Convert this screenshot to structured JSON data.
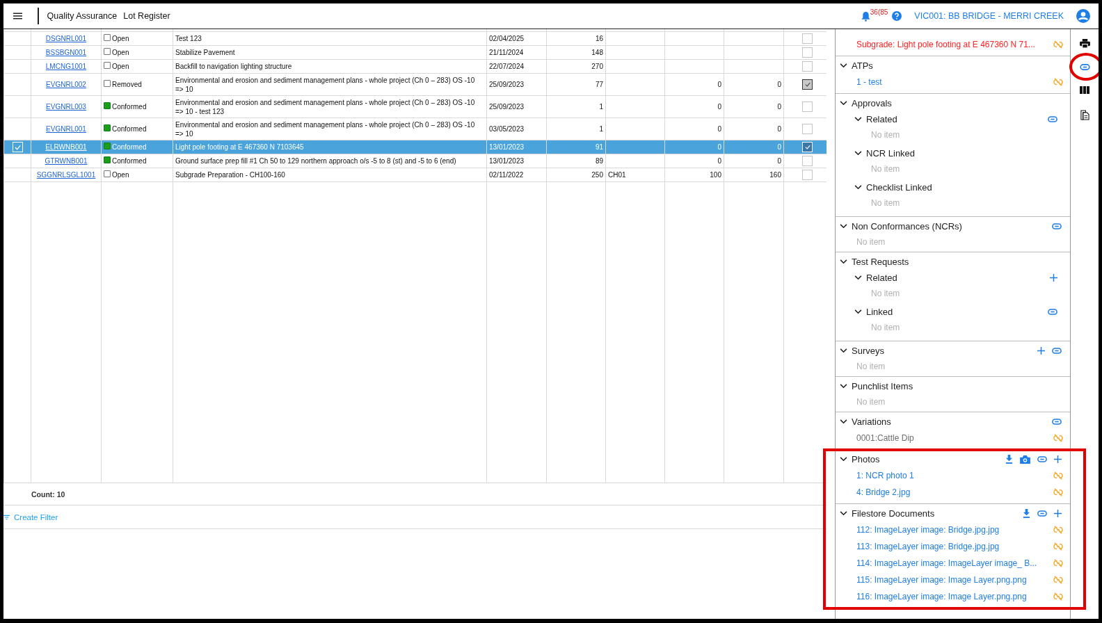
{
  "top_bar": {
    "module": "Quality Assurance",
    "page": "Lot Register",
    "notifications": "36(85",
    "project": "VIC001: BB BRIDGE - MERRI CREEK"
  },
  "table": {
    "rows": [
      {
        "selected": false,
        "lot": "DSGNRL001",
        "status_done": false,
        "status": "Open",
        "description": "Test 123",
        "date": "02/04/2025",
        "column_5": "16",
        "column_6": "",
        "column_7": "",
        "column_8": "",
        "checked": false
      },
      {
        "selected": false,
        "lot": "BSSBGN001",
        "status_done": false,
        "status": "Open",
        "description": "Stabilize Pavement",
        "date": "21/11/2024",
        "column_5": "148",
        "column_6": "",
        "column_7": "",
        "column_8": "",
        "checked": false
      },
      {
        "selected": false,
        "lot": "LMCNG1001",
        "status_done": false,
        "status": "Open",
        "description": "Backfill to navigation lighting structure",
        "date": "22/07/2024",
        "column_5": "270",
        "column_6": "",
        "column_7": "",
        "column_8": "",
        "checked": false
      },
      {
        "selected": false,
        "lot": "EVGNRL002",
        "status_done": false,
        "status": "Removed",
        "description": "Environmental and erosion and sediment management plans - whole project (Ch 0 – 283) OS -10 => 10",
        "date": "25/09/2023",
        "column_5": "77",
        "column_6": "",
        "column_7": "0",
        "column_8": "0",
        "checked": true
      },
      {
        "selected": false,
        "lot": "EVGNRL003",
        "status_done": true,
        "status": "Conformed",
        "description": "Environmental and erosion and sediment management plans - whole project (Ch 0 – 283) OS -10 => 10 - test 123",
        "date": "25/09/2023",
        "column_5": "1",
        "column_6": "",
        "column_7": "0",
        "column_8": "0",
        "checked": false
      },
      {
        "selected": false,
        "lot": "EVGNRL001",
        "status_done": true,
        "status": "Conformed",
        "description": "Environmental and erosion and sediment management plans - whole project (Ch 0 – 283) OS -10 => 10",
        "date": "03/05/2023",
        "column_5": "1",
        "column_6": "",
        "column_7": "0",
        "column_8": "0",
        "checked": false
      },
      {
        "selected": true,
        "lot": "ELRWNB001",
        "status_done": true,
        "status": "Conformed",
        "description": "Light pole footing at E 467360 N 7103645",
        "date": "13/01/2023",
        "column_5": "91",
        "column_6": "",
        "column_7": "0",
        "column_8": "0",
        "checked": true
      },
      {
        "selected": false,
        "lot": "GTRWNB001",
        "status_done": true,
        "status": "Conformed",
        "description": "Ground surface prep fill #1 Ch 50 to 129 northern approach o/s -5 to 8 (st) and -5 to 6 (end)",
        "date": "13/01/2023",
        "column_5": "89",
        "column_6": "",
        "column_7": "0",
        "column_8": "0",
        "checked": false
      },
      {
        "selected": false,
        "lot": "SGGNRLSGL1001",
        "status_done": false,
        "status": "Open",
        "description": "Subgrade Preparation - CH100-160",
        "date": "02/11/2022",
        "column_5": "250",
        "column_6": "CH01",
        "column_7": "100",
        "column_8": "160",
        "checked": false
      }
    ],
    "count": "Count: 10",
    "filter_link": "Create Filter"
  },
  "panel": {
    "sections": [
      {
        "items": [
          {
            "text": "Subgrade: Light pole footing at E 467360 N 71...",
            "color": "#ff2020"
          }
        ]
      },
      {
        "title": "ATPs",
        "items": [
          {
            "text": "1 - test",
            "color": "#1e7ee6"
          }
        ]
      },
      {
        "title": "Approvals",
        "subsections": [
          {
            "title": "Related",
            "actions": [
              {
                "kind": "link"
              }
            ],
            "empty": "No item"
          },
          {
            "title": "NCR Linked",
            "empty": "No item"
          },
          {
            "title": "Checklist Linked",
            "empty": "No item"
          }
        ]
      },
      {
        "title": "Non Conformances (NCRs)",
        "actions": [
          {
            "kind": "link"
          }
        ],
        "empty": "No item"
      },
      {
        "title": "Test Requests",
        "subsections": [
          {
            "title": "Related",
            "actions": [
              {
                "kind": "add"
              }
            ],
            "empty": "No item"
          },
          {
            "title": "Linked",
            "actions": [
              {
                "kind": "link"
              }
            ],
            "empty": "No item"
          }
        ]
      },
      {
        "title": "Surveys",
        "actions": [
          {
            "kind": "add"
          },
          {
            "kind": "link"
          }
        ],
        "empty": "No item"
      },
      {
        "title": "Punchlist Items",
        "empty": "No item"
      },
      {
        "title": "Variations",
        "actions": [
          {
            "kind": "link"
          }
        ],
        "items": [
          {
            "text": "0001:Cattle Dip",
            "color": "#6e6e6e"
          }
        ]
      },
      {
        "title": "Photos",
        "actions": [
          {
            "kind": "download"
          },
          {
            "kind": "camera"
          },
          {
            "kind": "link"
          },
          {
            "kind": "add"
          }
        ],
        "items": [
          {
            "text": "1: NCR photo 1",
            "color": "#1e7ee6"
          },
          {
            "text": "4: Bridge 2.jpg",
            "color": "#1e7ee6"
          }
        ]
      },
      {
        "title": "Filestore Documents",
        "actions": [
          {
            "kind": "download"
          },
          {
            "kind": "link"
          },
          {
            "kind": "add"
          }
        ],
        "items": [
          {
            "text": "112: ImageLayer image: Bridge.jpg.jpg",
            "color": "#1e7ee6"
          },
          {
            "text": "113: ImageLayer image: Bridge.jpg.jpg",
            "color": "#1e7ee6"
          },
          {
            "text": "114: ImageLayer image: ImageLayer image_ B...",
            "color": "#1e7ee6"
          },
          {
            "text": "115: ImageLayer image: Image Layer.png.png",
            "color": "#1e7ee6"
          },
          {
            "text": "116: ImageLayer image: Image Layer.png.png",
            "color": "#1e7ee6"
          }
        ]
      }
    ]
  }
}
